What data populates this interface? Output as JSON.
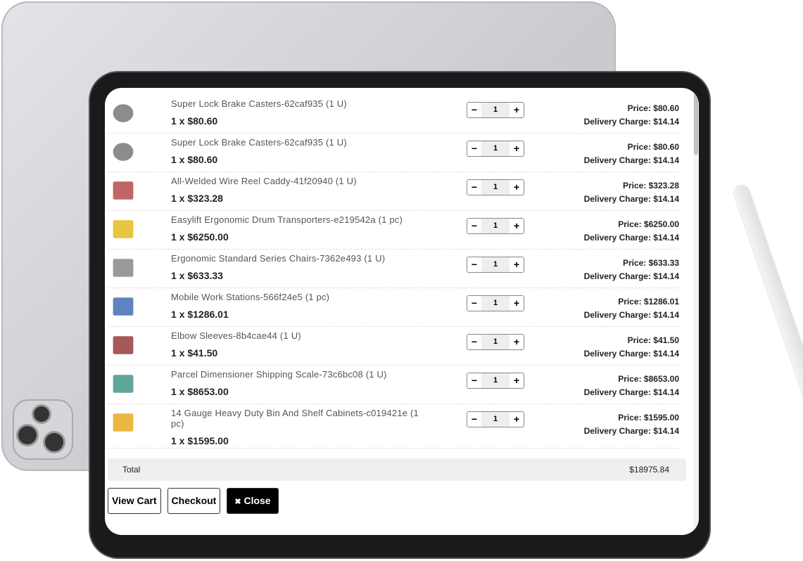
{
  "cart": {
    "items": [
      {
        "name": "Super Lock Brake Casters-62caf935 (1 U)",
        "qty_price": "1 x $80.60",
        "qty": "1",
        "price": "Price: $80.60",
        "delivery": "Delivery Charge: $14.14",
        "icon": "caster-wheel",
        "color": "#666"
      },
      {
        "name": "Super Lock Brake Casters-62caf935 (1 U)",
        "qty_price": "1 x $80.60",
        "qty": "1",
        "price": "Price: $80.60",
        "delivery": "Delivery Charge: $14.14",
        "icon": "caster-wheel",
        "color": "#666"
      },
      {
        "name": "All-Welded Wire Reel Caddy-41f20940 (1 U)",
        "qty_price": "1 x $323.28",
        "qty": "1",
        "price": "Price: $323.28",
        "delivery": "Delivery Charge: $14.14",
        "icon": "reel-caddy",
        "color": "#a33"
      },
      {
        "name": "Easylift Ergonomic Drum Transporters-e219542a (1 pc)",
        "qty_price": "1 x $6250.00",
        "qty": "1",
        "price": "Price: $6250.00",
        "delivery": "Delivery Charge: $14.14",
        "icon": "drum-transporter",
        "color": "#e0b000"
      },
      {
        "name": "Ergonomic Standard Series Chairs-7362e493 (1 U)",
        "qty_price": "1 x $633.33",
        "qty": "1",
        "price": "Price: $633.33",
        "delivery": "Delivery Charge: $14.14",
        "icon": "chair",
        "color": "#777"
      },
      {
        "name": "Mobile Work Stations-566f24e5 (1 pc)",
        "qty_price": "1 x $1286.01",
        "qty": "1",
        "price": "Price: $1286.01",
        "delivery": "Delivery Charge: $14.14",
        "icon": "work-station",
        "color": "#2a5aa8"
      },
      {
        "name": "Elbow Sleeves-8b4cae44 (1 U)",
        "qty_price": "1 x $41.50",
        "qty": "1",
        "price": "Price: $41.50",
        "delivery": "Delivery Charge: $14.14",
        "icon": "elbow-sleeves",
        "color": "#8a2020"
      },
      {
        "name": "Parcel Dimensioner Shipping Scale-73c6bc08 (1 U)",
        "qty_price": "1 x $8653.00",
        "qty": "1",
        "price": "Price: $8653.00",
        "delivery": "Delivery Charge: $14.14",
        "icon": "shipping-scale",
        "color": "#2a8a7a"
      },
      {
        "name": "14 Gauge Heavy Duty Bin And Shelf Cabinets-c019421e (1 pc)",
        "qty_price": "1 x $1595.00",
        "qty": "1",
        "price": "Price: $1595.00",
        "delivery": "Delivery Charge: $14.14",
        "icon": "bin-cabinet",
        "color": "#e0a000"
      }
    ],
    "minus": "−",
    "plus": "+",
    "total_label": "Total",
    "total_value": "$18975.84",
    "view_cart": "View Cart",
    "checkout": "Checkout",
    "close": "Close",
    "close_icon": "✖"
  }
}
